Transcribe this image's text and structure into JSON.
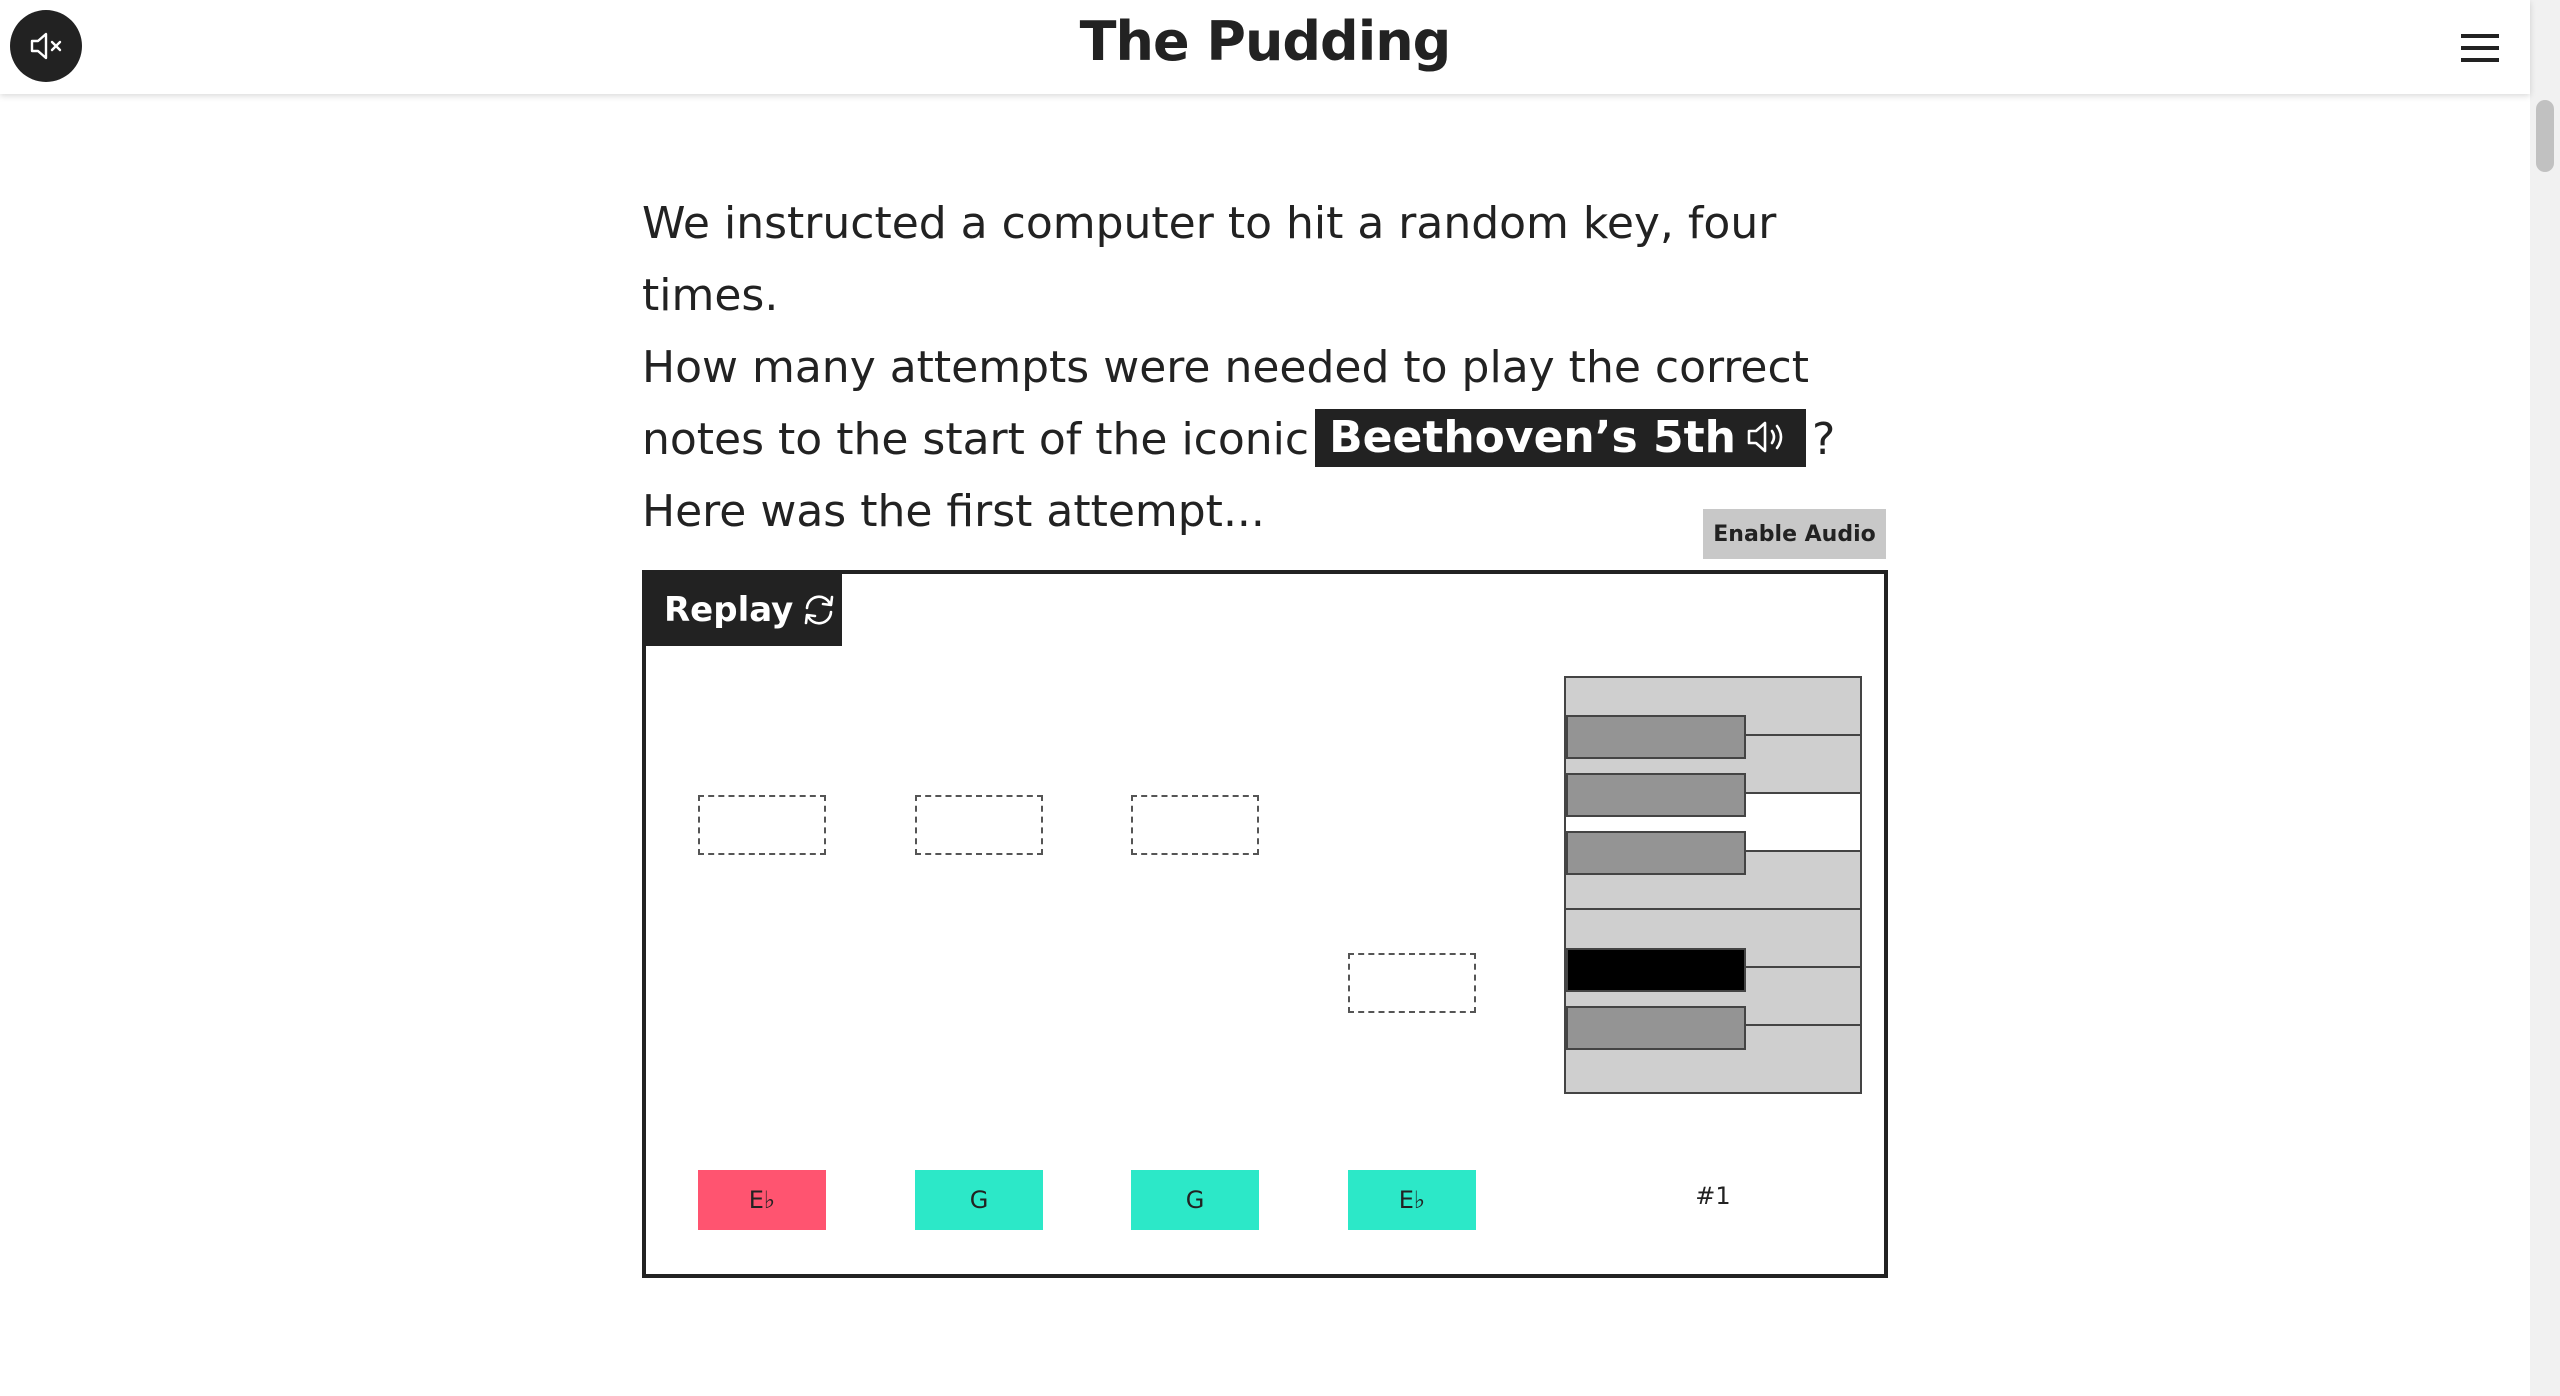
{
  "header": {
    "logo": "The Pudding",
    "mute_icon": "speaker-muted-icon",
    "menu_icon": "hamburger-menu-icon"
  },
  "prose": {
    "line1": "We instructed a computer to hit a random key, four times.",
    "line2": "How many attempts were needed to play the correct",
    "line3_before": "notes to the start of the iconic",
    "song": "Beethoven’s 5th",
    "song_icon": "speaker-sound-icon",
    "line3_after": "?",
    "line4": "Here was the first attempt..."
  },
  "controls": {
    "enable_audio": "Enable Audio",
    "replay": "Replay",
    "replay_icon": "refresh-icon"
  },
  "notes": [
    {
      "label": "E♭",
      "status": "wrong",
      "color": "#ff5470"
    },
    {
      "label": "G",
      "status": "correct",
      "color": "#2ce8c8"
    },
    {
      "label": "G",
      "status": "correct",
      "color": "#2ce8c8"
    },
    {
      "label": "E♭",
      "status": "correct",
      "color": "#2ce8c8"
    }
  ],
  "attempt": "#1",
  "colors": {
    "dark": "#222222",
    "wrong": "#ff5470",
    "correct": "#2ce8c8",
    "key_gray": "#cfcfcf",
    "black_key": "#949494",
    "active_key": "#000000"
  }
}
